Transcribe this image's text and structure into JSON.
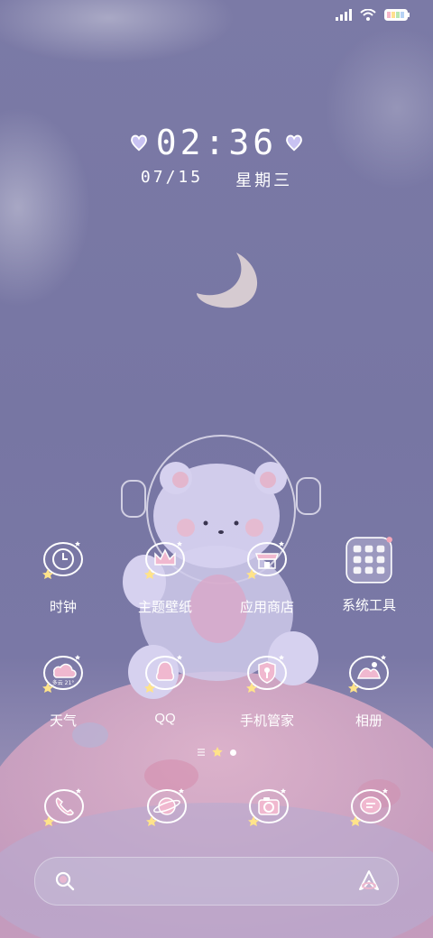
{
  "status_bar": {
    "signal_icon": "signal-icon",
    "wifi_icon": "wifi-icon",
    "battery_icon": "battery-icon"
  },
  "clock": {
    "time": "02:36",
    "date": "07/15",
    "weekday": "星期三"
  },
  "apps": [
    {
      "label": "时钟",
      "icon": "clock-icon"
    },
    {
      "label": "主题壁纸",
      "icon": "crown-icon"
    },
    {
      "label": "应用商店",
      "icon": "store-icon"
    },
    {
      "label": "系统工具",
      "icon": "folder-icon"
    },
    {
      "label": "天气",
      "icon": "weather-icon",
      "badge": "多云 21°"
    },
    {
      "label": "QQ",
      "icon": "qq-icon"
    },
    {
      "label": "手机管家",
      "icon": "shield-icon"
    },
    {
      "label": "相册",
      "icon": "gallery-icon"
    }
  ],
  "dock": [
    "phone-icon",
    "browser-icon",
    "camera-icon",
    "messages-icon"
  ],
  "page_indicator": {
    "pages": 3,
    "current": 2
  },
  "search_bar": {
    "search_icon": "search-icon",
    "assistant_icon": "assistant-icon"
  },
  "colors": {
    "background": "#7b7aa6",
    "accent_pink": "#e8b4c8",
    "star": "#ffe38a",
    "white": "#ffffff"
  }
}
